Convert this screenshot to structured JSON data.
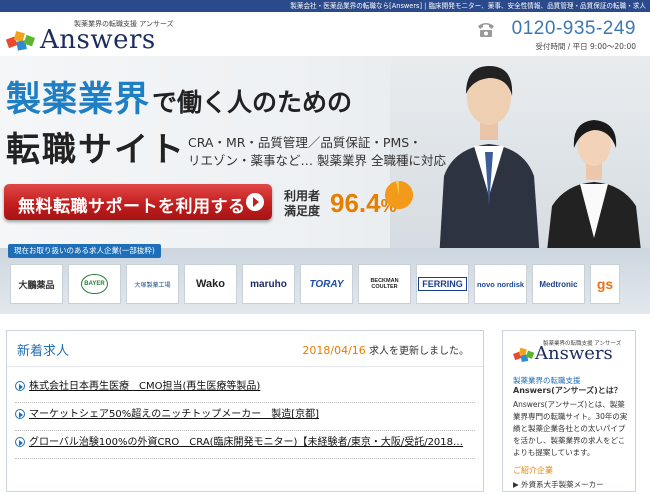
{
  "top_strip": "製薬会社・医薬品業界の転職なら[Answers] | 臨床開発モニター、薬事、安全性情報、品質管理・品質保証の転職・求人",
  "header": {
    "logo_tagline": "製薬業界の転職支援 アンサーズ",
    "logo_name": "Answers",
    "phone_number": "0120-935-249",
    "phone_hours": "受付時間 / 平日 9:00～20:00"
  },
  "hero": {
    "headline_blue": "製薬業界",
    "headline_black": "で働く人のための",
    "headline2": "転職サイト",
    "sub_line1": "CRA・MR・品質管理／品質保証・PMS・",
    "sub_line2": "リエゾン・薬事など… 製薬業界 全職種に対応",
    "cta_label": "無料転職サポートを利用する",
    "sat_label1": "利用者",
    "sat_label2": "満足度",
    "sat_value": "96.4",
    "sat_unit": "%",
    "sat_fraction": 0.964
  },
  "companies": {
    "label": "現在お取り扱いのある求人企業(一部抜粋)",
    "items": [
      {
        "name": "大鵬薬品"
      },
      {
        "name": "BAYER"
      },
      {
        "name": "大塚製薬工場"
      },
      {
        "name": "Wako"
      },
      {
        "name": "maruho"
      },
      {
        "name": "TORAY"
      },
      {
        "name": "BECKMAN COULTER"
      },
      {
        "name": "FERRING"
      },
      {
        "name": "novo nordisk"
      },
      {
        "name": "Medtronic"
      },
      {
        "name": "gs"
      }
    ]
  },
  "news": {
    "title": "新着求人",
    "date": "2018/04/16",
    "date_suffix": "求人を更新しました。",
    "items": [
      "株式会社日本再生医療　CMO担当(再生医療等製品)",
      "マーケットシェア50%超えのニッチトップメーカー　製造[京都]",
      "グローバル治験100%の外資CRO　CRA(臨床開発モニター)【未経験者/東京・大阪/受託/2018…"
    ]
  },
  "sidebar": {
    "logo_tagline": "製薬業界の転職支援 アンサーズ",
    "logo_name": "Answers",
    "heading1": "製薬業界の転職支援",
    "heading2": "Answers(アンサーズ)とは？",
    "text": "Answers(アンサーズ)とは、製薬業界専門の転職サイト。30年の実績と製薬企業各社との太いパイプを活かし、製薬業界の求人をどこよりも提案しています。",
    "heading3": "ご紹介企業",
    "list_item": "外資系大手製薬メーカー"
  },
  "colors": {
    "brand_blue": "#1f7fc4",
    "cta_red": "#c41e1e",
    "accent_orange": "#e67e00",
    "navy": "#1c2d5e"
  }
}
